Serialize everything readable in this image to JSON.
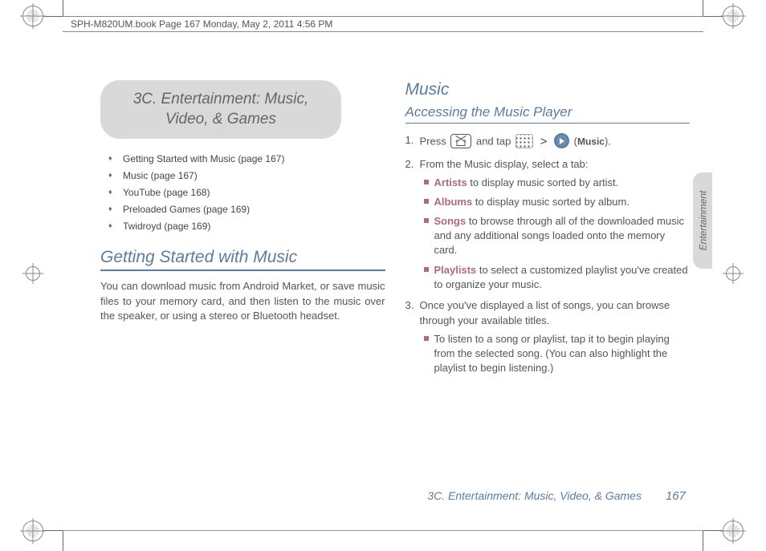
{
  "header": {
    "text": "SPH-M820UM.book  Page 167  Monday, May 2, 2011  4:56 PM"
  },
  "section_cap": {
    "line1": "3C. Entertainment: Music,",
    "line2": "Video, & Games"
  },
  "toc": [
    "Getting Started with Music (page 167)",
    "Music (page 167)",
    "YouTube (page 168)",
    "Preloaded Games (page 169)",
    "Twidroyd (page 169)"
  ],
  "left": {
    "h2": "Getting Started with Music",
    "body": "You can download music from Android Market, or save music files to your memory card, and then listen to the music over the speaker, or using a stereo or Bluetooth headset."
  },
  "right": {
    "h2": "Music",
    "h3": "Accessing the Music Player",
    "step1_a": "Press ",
    "step1_b": " and tap ",
    "step1_c": "(",
    "step1_label": "Music",
    "step1_d": ").",
    "step2": "From the Music display, select a tab:",
    "tabs": {
      "artists_label": "Artists",
      "artists_rest": " to display music sorted by artist.",
      "albums_label": "Albums",
      "albums_rest": " to display music sorted by album.",
      "songs_label": "Songs",
      "songs_rest": " to browse through all of the downloaded music and any additional songs loaded onto the memory card.",
      "playlists_label": "Playlists",
      "playlists_rest": " to select a customized playlist you've created to organize your music."
    },
    "step3": "Once you've displayed a list of songs, you can browse through your available titles.",
    "step3_sub": "To listen to a song or playlist, tap it to begin playing from the selected song. (You can also highlight the playlist to begin listening.)"
  },
  "side_tab": "Entertainment",
  "footer": {
    "text": "3C. Entertainment: Music, Video, & Games",
    "page": "167"
  }
}
